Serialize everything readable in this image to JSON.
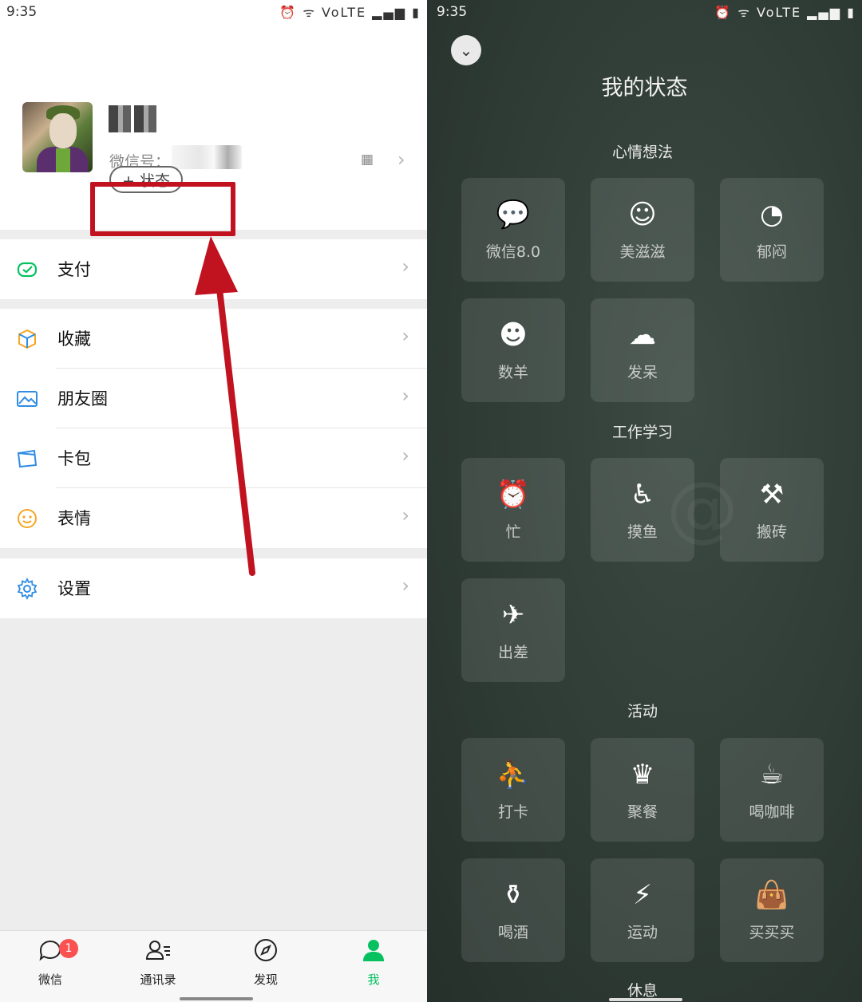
{
  "left": {
    "status_time": "9:35",
    "status_icons": "⏰ ᯤ VoLTE ▂▄▆ ▮",
    "profile": {
      "wechat_id_label": "微信号：",
      "status_button": "+ 状态"
    },
    "menu": [
      {
        "label": "支付",
        "icon": "pay-icon",
        "color": "#07c160"
      },
      {
        "label": "收藏",
        "icon": "favorites-cube-icon",
        "color": "#f6a623"
      },
      {
        "label": "朋友圈",
        "icon": "moments-image-icon",
        "color": "#2f8de4"
      },
      {
        "label": "卡包",
        "icon": "card-wallet-icon",
        "color": "#2f8de4"
      },
      {
        "label": "表情",
        "icon": "emoji-face-icon",
        "color": "#f6a623"
      },
      {
        "label": "设置",
        "icon": "settings-gear-icon",
        "color": "#2f8de4"
      }
    ],
    "tabs": [
      {
        "label": "微信",
        "icon": "chat-bubble-icon",
        "badge": "1"
      },
      {
        "label": "通讯录",
        "icon": "contacts-icon"
      },
      {
        "label": "发现",
        "icon": "compass-icon"
      },
      {
        "label": "我",
        "icon": "person-icon",
        "active": true
      }
    ],
    "annotation_color": "#c1121f"
  },
  "right": {
    "status_time": "9:35",
    "status_icons": "⏰ ᯤ VoLTE ▂▄▆ ▮",
    "title": "我的状态",
    "sections": {
      "mood": "心情想法",
      "work": "工作学习",
      "activity": "活动",
      "rest": "休息"
    },
    "tiles": {
      "wechat8": "微信8.0",
      "happy": "美滋滋",
      "gloomy": "郁闷",
      "counting_sheep": "数羊",
      "daze": "发呆",
      "busy": "忙",
      "slacking": "摸鱼",
      "moving_bricks": "搬砖",
      "business_trip": "出差",
      "check_in": "打卡",
      "dinner_party": "聚餐",
      "coffee": "喝咖啡",
      "drinking": "喝酒",
      "exercise": "运动",
      "shopping": "买买买"
    }
  }
}
